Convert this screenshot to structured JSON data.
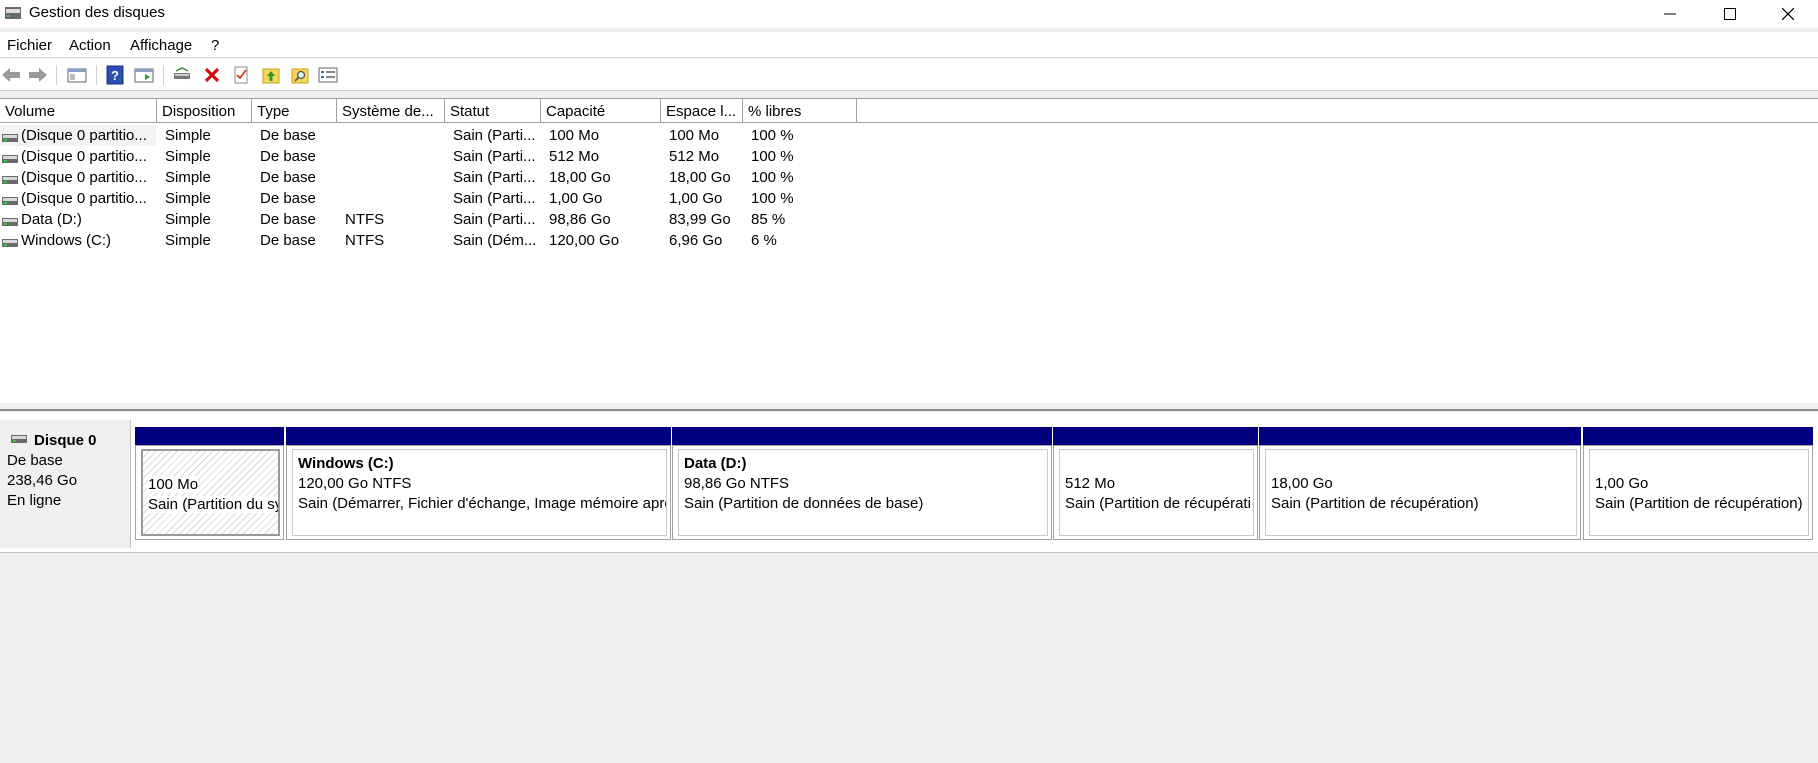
{
  "window": {
    "title": "Gestion des disques"
  },
  "menu": {
    "items": [
      "Fichier",
      "Action",
      "Affichage",
      "?"
    ]
  },
  "toolbar": {
    "icons": [
      "back-arrow-icon",
      "forward-arrow-icon",
      "console-tree-icon",
      "help-icon",
      "properties-pane-icon",
      "connect-disk-icon",
      "delete-icon",
      "checklist-icon",
      "folder-up-icon",
      "folder-search-icon",
      "properties-icon"
    ]
  },
  "volume_list": {
    "columns": [
      "Volume",
      "Disposition",
      "Type",
      "Système de...",
      "Statut",
      "Capacité",
      "Espace l...",
      "% libres"
    ],
    "rows": [
      {
        "volume": "(Disque 0 partitio...",
        "disposition": "Simple",
        "type": "De base",
        "fs": "",
        "status": "Sain (Parti...",
        "capacity": "100 Mo",
        "free": "100 Mo",
        "pct": "100 %"
      },
      {
        "volume": "(Disque 0 partitio...",
        "disposition": "Simple",
        "type": "De base",
        "fs": "",
        "status": "Sain (Parti...",
        "capacity": "512 Mo",
        "free": "512 Mo",
        "pct": "100 %"
      },
      {
        "volume": "(Disque 0 partitio...",
        "disposition": "Simple",
        "type": "De base",
        "fs": "",
        "status": "Sain (Parti...",
        "capacity": "18,00 Go",
        "free": "18,00 Go",
        "pct": "100 %"
      },
      {
        "volume": "(Disque 0 partitio...",
        "disposition": "Simple",
        "type": "De base",
        "fs": "",
        "status": "Sain (Parti...",
        "capacity": "1,00 Go",
        "free": "1,00 Go",
        "pct": "100 %"
      },
      {
        "volume": "Data (D:)",
        "disposition": "Simple",
        "type": "De base",
        "fs": "NTFS",
        "status": "Sain (Parti...",
        "capacity": "98,86 Go",
        "free": "83,99 Go",
        "pct": "85 %"
      },
      {
        "volume": "Windows (C:)",
        "disposition": "Simple",
        "type": "De base",
        "fs": "NTFS",
        "status": "Sain (Dém...",
        "capacity": "120,00 Go",
        "free": "6,96 Go",
        "pct": "6 %"
      }
    ]
  },
  "disk": {
    "name": "Disque 0",
    "type": "De base",
    "size": "238,46 Go",
    "state": "En ligne",
    "partitions": [
      {
        "title": "",
        "size": "100 Mo",
        "status": "Sain (Partition du sy"
      },
      {
        "title": "Windows  (C:)",
        "size": "120,00 Go NTFS",
        "status": "Sain (Démarrer, Fichier d'échange, Image mémoire apré"
      },
      {
        "title": "Data  (D:)",
        "size": "98,86 Go NTFS",
        "status": "Sain (Partition de données de base)"
      },
      {
        "title": "",
        "size": "512 Mo",
        "status": "Sain (Partition de récupérati·"
      },
      {
        "title": "",
        "size": "18,00 Go",
        "status": "Sain (Partition de récupération)"
      },
      {
        "title": "",
        "size": "1,00 Go",
        "status": "Sain (Partition de récupération)"
      }
    ]
  },
  "colors": {
    "partition_bar": "#000080",
    "delete_icon": "#d01010"
  }
}
